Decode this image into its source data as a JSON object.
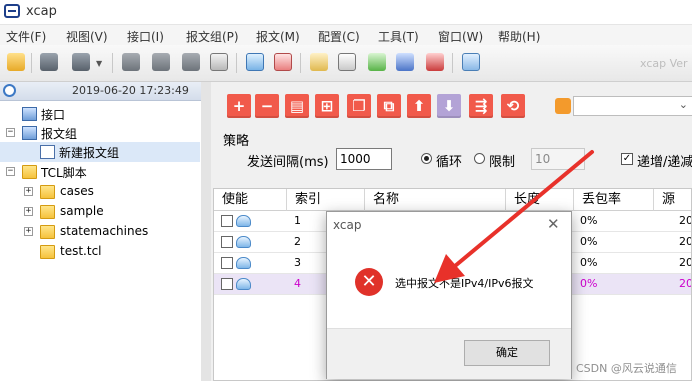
{
  "app": {
    "title": "xcap"
  },
  "menu": [
    "文件(F)",
    "视图(V)",
    "接口(I)",
    "报文组(P)",
    "报文(M)",
    "配置(C)",
    "工具(T)",
    "窗口(W)",
    "帮助(H)"
  ],
  "toolbar": {
    "ghost_text": "xcap Ver"
  },
  "left_panel": {
    "datetime": "2019-06-20  17:23:49",
    "tree": [
      {
        "label": "接口"
      },
      {
        "label": "报文组"
      },
      {
        "label": "新建报文组"
      },
      {
        "label": "TCL脚本"
      },
      {
        "label": "cases"
      },
      {
        "label": "sample"
      },
      {
        "label": "statemachines"
      },
      {
        "label": "test.tcl"
      }
    ]
  },
  "right_panel": {
    "button_glyphs": [
      "+",
      "−",
      "▤",
      "⊞",
      "❐",
      "⧉",
      "⬆",
      "⬇",
      "⇶",
      "⟲"
    ],
    "strategy": {
      "title": "策略",
      "interval_label": "发送间隔(ms)",
      "interval_value": "1000",
      "loop_label": "循环",
      "limit_label": "限制",
      "limit_value": "10",
      "increment_label": "递增/递减"
    },
    "table": {
      "headers": [
        "使能",
        "索引",
        "名称",
        "长度",
        "丢包率",
        "源"
      ],
      "rows": [
        {
          "index": "1",
          "loss": "0%",
          "src": "20"
        },
        {
          "index": "2",
          "loss": "0%",
          "src": "20"
        },
        {
          "index": "3",
          "loss": "0%",
          "src": "20"
        },
        {
          "index": "4",
          "loss": "0%",
          "src": "20"
        }
      ]
    }
  },
  "dialog": {
    "title": "xcap",
    "close": "✕",
    "message": "选中报文不是IPv4/IPv6报文",
    "ok": "确定"
  },
  "watermark": "CSDN @风云说通信",
  "colors": {
    "accent_button": "#f15a4b",
    "error": "#e0322a",
    "arrow": "#e8312a",
    "highlight_row_text": "#cc00cc"
  }
}
